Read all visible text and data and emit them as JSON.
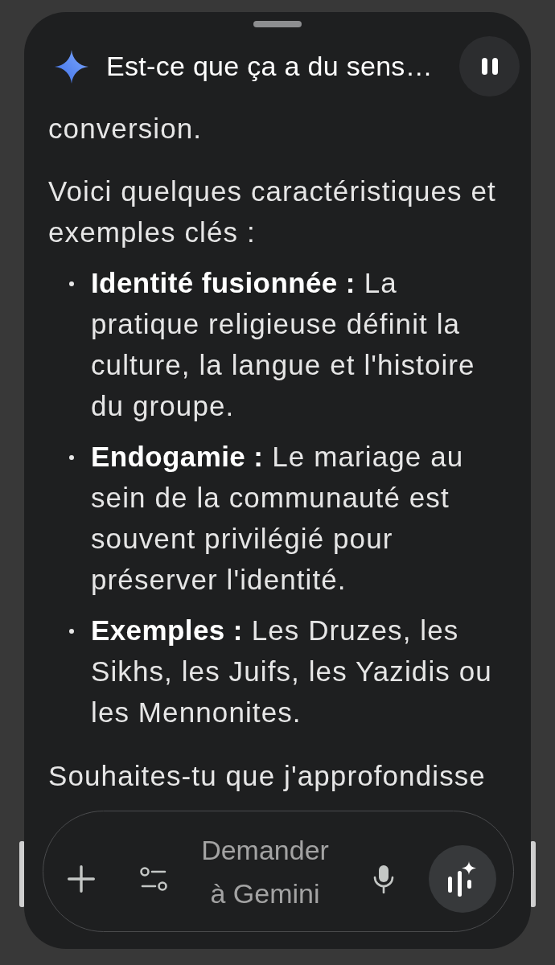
{
  "header": {
    "title": "Est-ce que ça a du sens…"
  },
  "message": [
    {
      "kind": "paragraph",
      "text": "conversion."
    },
    {
      "kind": "paragraph",
      "text": "Voici quelques caractéristiques et exemples clés :"
    },
    {
      "kind": "bullets",
      "items": [
        "**Identité fusionnée :** La pratique religieuse définit la culture, la langue et l'histoire du groupe.",
        "**Endogamie :** Le mariage au sein de la communauté est souvent privilégié pour préserver l'identité.",
        "**Exemples :** Les Druzes, les Sikhs, les Juifs, les Yazidis ou les Mennonites."
      ]
    },
    {
      "kind": "paragraph",
      "text": "Souhaites-tu que j'approfondisse"
    }
  ],
  "composer": {
    "placeholder": "Demander à Gemini"
  }
}
